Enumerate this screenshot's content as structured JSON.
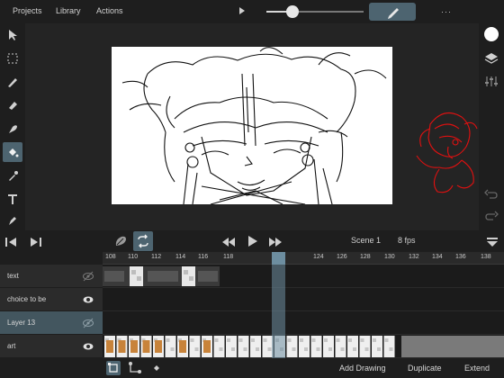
{
  "menu": {
    "projects": "Projects",
    "library": "Library",
    "actions": "Actions",
    "more": "···"
  },
  "brush_slider": {
    "level": 0.27
  },
  "playback": {
    "scene": "Scene 1",
    "fps": "8 fps"
  },
  "timeline": {
    "ticks": [
      "108",
      "110",
      "112",
      "114",
      "116",
      "118",
      "121",
      "124",
      "126",
      "128",
      "130",
      "132",
      "134",
      "136",
      "138"
    ],
    "current_frame": "121"
  },
  "layers": [
    {
      "name": "text",
      "visible": false,
      "active": false
    },
    {
      "name": "choice to be",
      "visible": true,
      "active": false
    },
    {
      "name": "Layer 13",
      "visible": false,
      "active": true
    },
    {
      "name": "art",
      "visible": true,
      "active": false
    }
  ],
  "bottom": {
    "add_drawing": "Add Drawing",
    "duplicate": "Duplicate",
    "extend": "Extend"
  },
  "colors": {
    "accent": "#4d6470",
    "sketch_red": "#e01010",
    "frame_orange": "#c8833a"
  }
}
